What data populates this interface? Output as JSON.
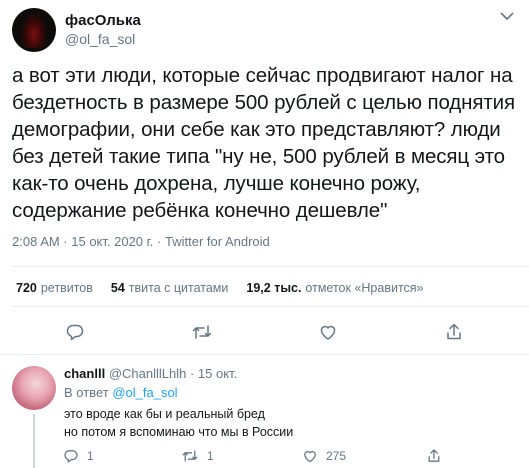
{
  "tweet": {
    "author_name": "фасОлька",
    "author_handle": "@ol_fa_sol",
    "text": "а вот эти люди, которые сейчас продвигают налог на бездетность в размере 500 рублей с целью поднятия демографии, они себе как это представляют? люди без детей такие типа \"ну не, 500 рублей в месяц это как-то очень дохрена, лучше конечно рожу, содержание ребёнка конечно дешевле\"",
    "timestamp": "2:08 AM · 15 окт. 2020 г.",
    "separator": " · ",
    "source": "Twitter for Android"
  },
  "stats": {
    "retweets_count": "720",
    "retweets_label": "ретвитов",
    "quotes_count": "54",
    "quotes_label": "твита с цитатами",
    "likes_count": "19,2 тыс.",
    "likes_label": "отметок «Нравится»"
  },
  "reply": {
    "author_name": "chanlll",
    "author_handle": "@ChanlllLhlh",
    "time": "· 15 окт.",
    "reply_to_prefix": "В ответ",
    "reply_to_mention": "@ol_fa_sol",
    "text_line1": "это вроде как бы и реальный бред",
    "text_line2": "но потом я вспоминаю что мы в России",
    "replies_count": "1",
    "retweets_count": "1",
    "likes_count": "275"
  },
  "colors": {
    "text": "#14171a",
    "secondary": "#657786",
    "link": "#1da1f2",
    "divider": "#e6ecf0"
  }
}
